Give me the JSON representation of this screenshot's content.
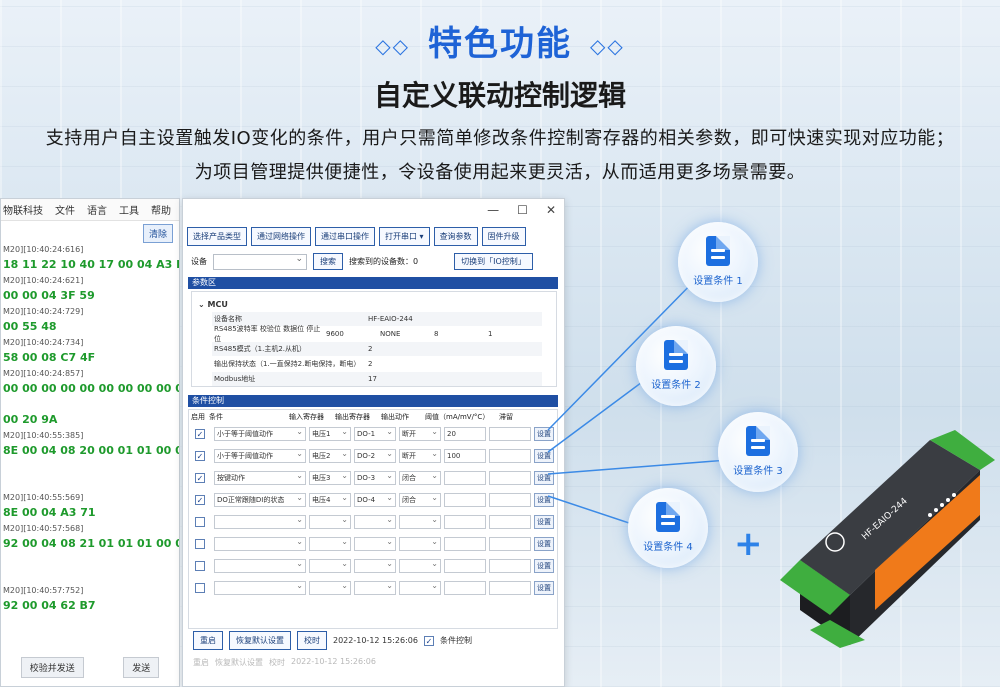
{
  "header": {
    "title": "特色功能",
    "deco": "◇◇",
    "subtitle": "自定义联动控制逻辑",
    "desc_line1": "支持用户自主设置触发IO变化的条件，用户只需简单修改条件控制寄存器的相关参数，即可快速实现对应功能；",
    "desc_line2": "为项目管理提供便捷性，令设备使用起来更灵活，从而适用更多场景需要。"
  },
  "left_window": {
    "menu": [
      "物联科技",
      "文件",
      "语言",
      "工具",
      "帮助"
    ],
    "clear_label": "清除",
    "log": [
      {
        "time": "M20][10:40:24:616]",
        "hex": "18 11 22 10 40 17 00 04 A3 FA"
      },
      {
        "time": "M20][10:40:24:621]",
        "hex": "00 00 04 3F 59"
      },
      {
        "time": "M20][10:40:24:729]",
        "hex": "00 55 48"
      },
      {
        "time": "M20][10:40:24:734]",
        "hex": "58 00 08 C7 4F"
      },
      {
        "time": "M20][10:40:24:857]",
        "hex": "00 00 00 00 00 00 00 00 00 00 00"
      },
      {
        "time": "",
        "hex": "00 20 9A"
      },
      {
        "time": "M20][10:40:55:385]",
        "hex": "8E 00 04 08 20 00 01 01 00 00 00 00"
      },
      {
        "time": "",
        "hex": ""
      },
      {
        "time": "M20][10:40:55:569]",
        "hex": "8E 00 04 A3 71"
      },
      {
        "time": "M20][10:40:57:568]",
        "hex": "92 00 04 08 21 01 01 01 00 00 00 00"
      },
      {
        "time": "",
        "hex": ""
      },
      {
        "time": "M20][10:40:57:752]",
        "hex": "92 00 04 62 B7"
      }
    ],
    "btn_checksum": "校验并发送",
    "btn_send": "发送"
  },
  "main_window": {
    "toolbar": [
      "选择产品类型",
      "通过网络操作",
      "通过串口操作",
      "打开串口 ▾",
      "查询参数",
      "固件升级"
    ],
    "device_label": "设备",
    "search_label": "搜索",
    "found_label": "搜索到的设备数：0",
    "switch_label": "切换到「IO控制」",
    "params_header": "参数区",
    "mcu_title": "MCU",
    "params": [
      {
        "key": "设备名称",
        "vals": [
          "HF-EAIO-244"
        ]
      },
      {
        "key": "RS485波特率  校验位  数据位  停止位",
        "vals": [
          "9600",
          "NONE",
          "8",
          "1"
        ]
      },
      {
        "key": "RS485模式（1.主机2.从机）",
        "vals": [
          "2"
        ]
      },
      {
        "key": "输出保持状态（1.一直保持2.断电保持，断电）",
        "vals": [
          "2"
        ]
      },
      {
        "key": "Modbus地址",
        "vals": [
          "17"
        ]
      }
    ],
    "cond_header": "条件控制",
    "cond_columns": [
      "启用",
      "条件",
      "输入寄存器",
      "输出寄存器",
      "输出动作",
      "阈值（mA/mV/°C）",
      "滞留"
    ],
    "cond_rows": [
      {
        "checked": "✓",
        "cond": "小于等于阈值动作",
        "in": "电压1",
        "out": "DO-1",
        "act": "断开",
        "th": "20",
        "set": "设置"
      },
      {
        "checked": "✓",
        "cond": "小于等于阈值动作",
        "in": "电压2",
        "out": "DO-2",
        "act": "断开",
        "th": "100",
        "set": "设置"
      },
      {
        "checked": "✓",
        "cond": "按键动作",
        "in": "电压3",
        "out": "DO-3",
        "act": "闭合",
        "th": "",
        "set": "设置"
      },
      {
        "checked": "✓",
        "cond": "DO正常跟随DI的状态",
        "in": "电压4",
        "out": "DO-4",
        "act": "闭合",
        "th": "",
        "set": "设置"
      },
      {
        "checked": "",
        "cond": "",
        "in": "",
        "out": "",
        "act": "",
        "th": "",
        "set": "设置"
      },
      {
        "checked": "",
        "cond": "",
        "in": "",
        "out": "",
        "act": "",
        "th": "",
        "set": "设置"
      },
      {
        "checked": "",
        "cond": "",
        "in": "",
        "out": "",
        "act": "",
        "th": "",
        "set": "设置"
      },
      {
        "checked": "",
        "cond": "",
        "in": "",
        "out": "",
        "act": "",
        "th": "",
        "set": "设置"
      }
    ],
    "footer": {
      "reboot": "重启",
      "restore": "恢复默认设置",
      "sync": "校时",
      "time": "2022-10-12 15:26:06",
      "cond_ctrl": "条件控制"
    }
  },
  "bubbles": [
    "设置条件 1",
    "设置条件 2",
    "设置条件 3",
    "设置条件 4"
  ],
  "device_label": "HF-EAIO-244",
  "colors": {
    "accent": "#1e63d6",
    "section": "#1f4fa3",
    "hex_text": "#1e9a2c",
    "device_orange": "#f07a1a"
  }
}
